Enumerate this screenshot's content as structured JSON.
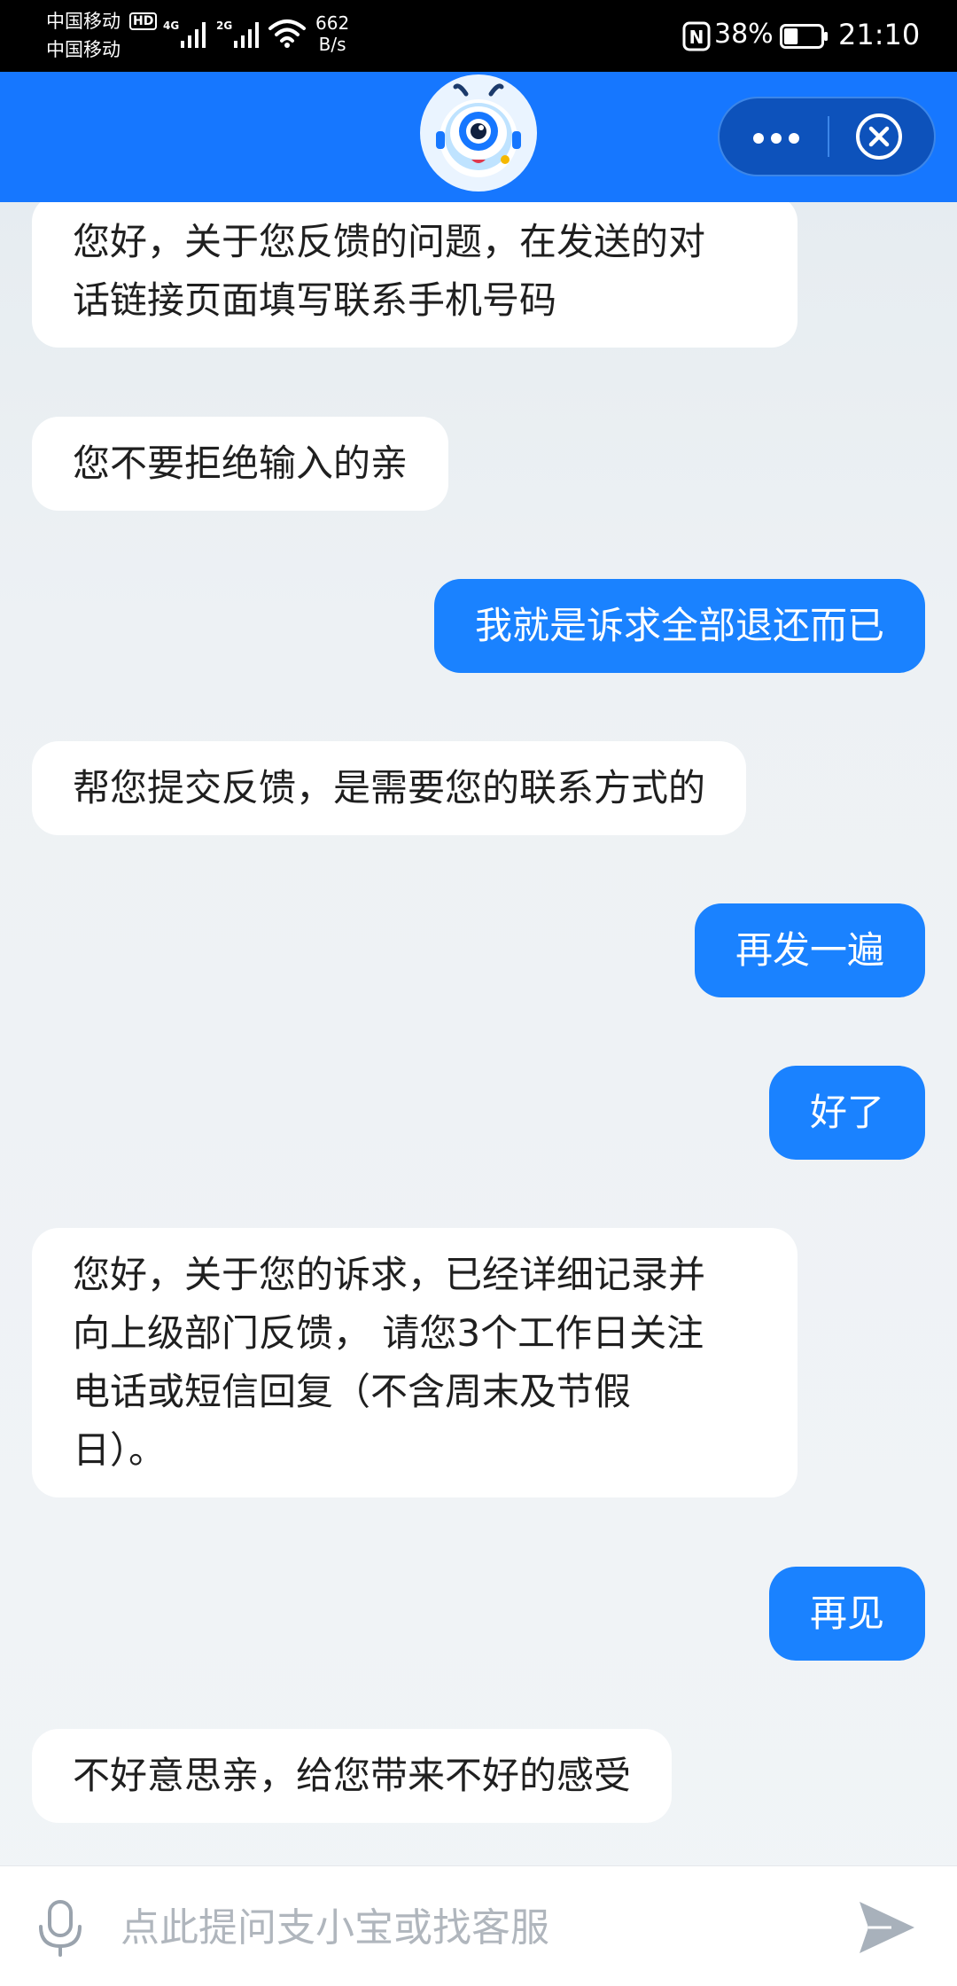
{
  "status_bar": {
    "carrier_1": "中国移动",
    "carrier_2": "中国移动",
    "hd_badge": "HD",
    "network_1": "4G",
    "network_2": "2G",
    "speed_value": "662",
    "speed_unit": "B/s",
    "nfc_label": "N",
    "battery_percent": "38%",
    "battery_level": 0.38,
    "time": "21:10",
    "icons": [
      "hd-icon",
      "signal-4g-icon",
      "signal-2g-icon",
      "wifi-icon",
      "nfc-icon",
      "battery-icon"
    ]
  },
  "header": {
    "avatar_icon": "robot-mascot-icon",
    "more_icon": "more-dots-icon",
    "close_icon": "close-circle-icon",
    "background_color": "#1677ff",
    "capsule_color": "#0d52bb"
  },
  "messages": [
    {
      "sender": "bot",
      "text": "您好，关于您反馈的问题，在发送的对\n话链接页面填写联系手机号码"
    },
    {
      "sender": "bot",
      "text": "您不要拒绝输入的亲"
    },
    {
      "sender": "user",
      "text": "我就是诉求全部退还而已"
    },
    {
      "sender": "bot",
      "text": "帮您提交反馈，是需要您的联系方式的"
    },
    {
      "sender": "user",
      "text": "再发一遍"
    },
    {
      "sender": "user",
      "text": "好了"
    },
    {
      "sender": "bot",
      "text": "您好，关于您的诉求，已经详细记录并\n向上级部门反馈， 请您3个工作日关注\n电话或短信回复（不含周末及节假\n日）。"
    },
    {
      "sender": "user",
      "text": "再见"
    },
    {
      "sender": "bot",
      "text": "不好意思亲，给您带来不好的感受"
    }
  ],
  "colors": {
    "user_bubble": "#1a82ff",
    "bot_bubble": "#ffffff"
  },
  "input_bar": {
    "placeholder": "点此提问支小宝或找客服",
    "mic_icon": "microphone-icon",
    "send_icon": "send-icon"
  }
}
